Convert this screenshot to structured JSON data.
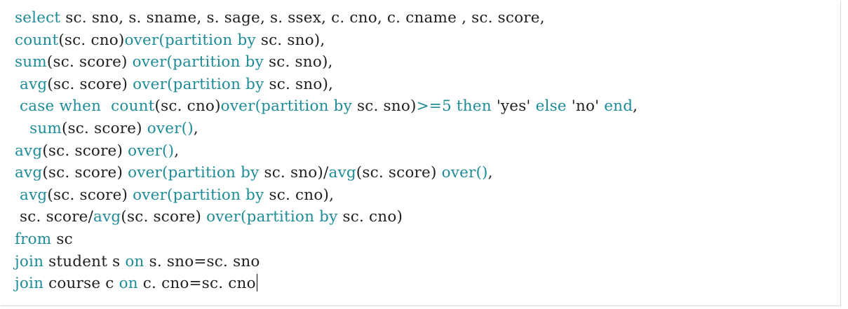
{
  "colors": {
    "keyword": "#1e8c97",
    "plain": "#1f1f1f",
    "background": "#ffffff"
  },
  "code_lines": [
    [
      [
        "kw",
        "select"
      ],
      [
        "t",
        " sc. sno, s. sname, s. sage, s. ssex, c. cno, c. cname , sc. score,"
      ]
    ],
    [
      [
        "kw",
        "count"
      ],
      [
        "t",
        "(sc. cno)"
      ],
      [
        "kw",
        "over(partition by"
      ],
      [
        "t",
        " sc. sno),"
      ]
    ],
    [
      [
        "kw",
        "sum"
      ],
      [
        "t",
        "(sc. score) "
      ],
      [
        "kw",
        "over(partition by"
      ],
      [
        "t",
        " sc. sno),"
      ]
    ],
    [
      [
        "t",
        " "
      ],
      [
        "kw",
        "avg"
      ],
      [
        "t",
        "(sc. score) "
      ],
      [
        "kw",
        "over(partition by"
      ],
      [
        "t",
        " sc. sno),"
      ]
    ],
    [
      [
        "t",
        " "
      ],
      [
        "kw",
        "case when  count"
      ],
      [
        "t",
        "(sc. cno)"
      ],
      [
        "kw",
        "over(partition by"
      ],
      [
        "t",
        " sc. sno)"
      ],
      [
        "kw",
        ">=5 then"
      ],
      [
        "t",
        " 'yes' "
      ],
      [
        "kw",
        "else"
      ],
      [
        "t",
        " 'no' "
      ],
      [
        "kw",
        "end"
      ],
      [
        "t",
        ","
      ]
    ],
    [
      [
        "t",
        "   "
      ],
      [
        "kw",
        "sum"
      ],
      [
        "t",
        "(sc. score) "
      ],
      [
        "kw",
        "over()"
      ],
      [
        "t",
        ","
      ]
    ],
    [
      [
        "kw",
        "avg"
      ],
      [
        "t",
        "(sc. score) "
      ],
      [
        "kw",
        "over()"
      ],
      [
        "t",
        ","
      ]
    ],
    [
      [
        "kw",
        "avg"
      ],
      [
        "t",
        "(sc. score) "
      ],
      [
        "kw",
        "over(partition by"
      ],
      [
        "t",
        " sc. sno)/"
      ],
      [
        "kw",
        "avg"
      ],
      [
        "t",
        "(sc. score) "
      ],
      [
        "kw",
        "over()"
      ],
      [
        "t",
        ","
      ]
    ],
    [
      [
        "t",
        " "
      ],
      [
        "kw",
        "avg"
      ],
      [
        "t",
        "(sc. score) "
      ],
      [
        "kw",
        "over(partition by"
      ],
      [
        "t",
        " sc. cno),"
      ]
    ],
    [
      [
        "t",
        " sc. score/"
      ],
      [
        "kw",
        "avg"
      ],
      [
        "t",
        "(sc. score) "
      ],
      [
        "kw",
        "over(partition by"
      ],
      [
        "t",
        " sc. cno)"
      ]
    ],
    [
      [
        "kw",
        "from"
      ],
      [
        "t",
        " sc"
      ]
    ],
    [
      [
        "kw",
        "join"
      ],
      [
        "t",
        " student s "
      ],
      [
        "kw",
        "on"
      ],
      [
        "t",
        " s. sno=sc. sno"
      ]
    ],
    [
      [
        "kw",
        "join"
      ],
      [
        "t",
        " course c "
      ],
      [
        "kw",
        "on"
      ],
      [
        "t",
        " c. cno=sc. cno"
      ]
    ]
  ],
  "caret_line": 12
}
